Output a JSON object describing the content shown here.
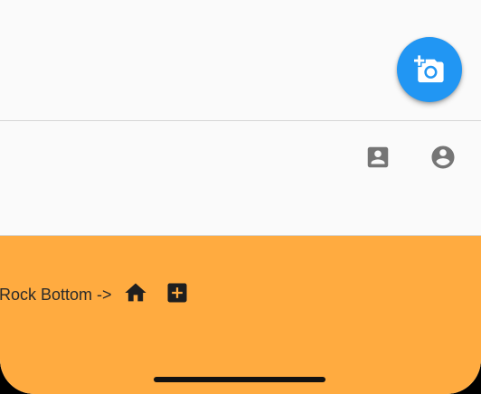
{
  "fab": {
    "icon": "add-a-photo-icon",
    "color": "#2196f3"
  },
  "mid_actions": [
    {
      "icon": "contact-card-icon"
    },
    {
      "icon": "account-circle-icon"
    }
  ],
  "bottom_bar": {
    "label": "Rock Bottom ->",
    "background": "#ffab40",
    "icons": [
      "home-icon",
      "add-box-icon"
    ]
  }
}
